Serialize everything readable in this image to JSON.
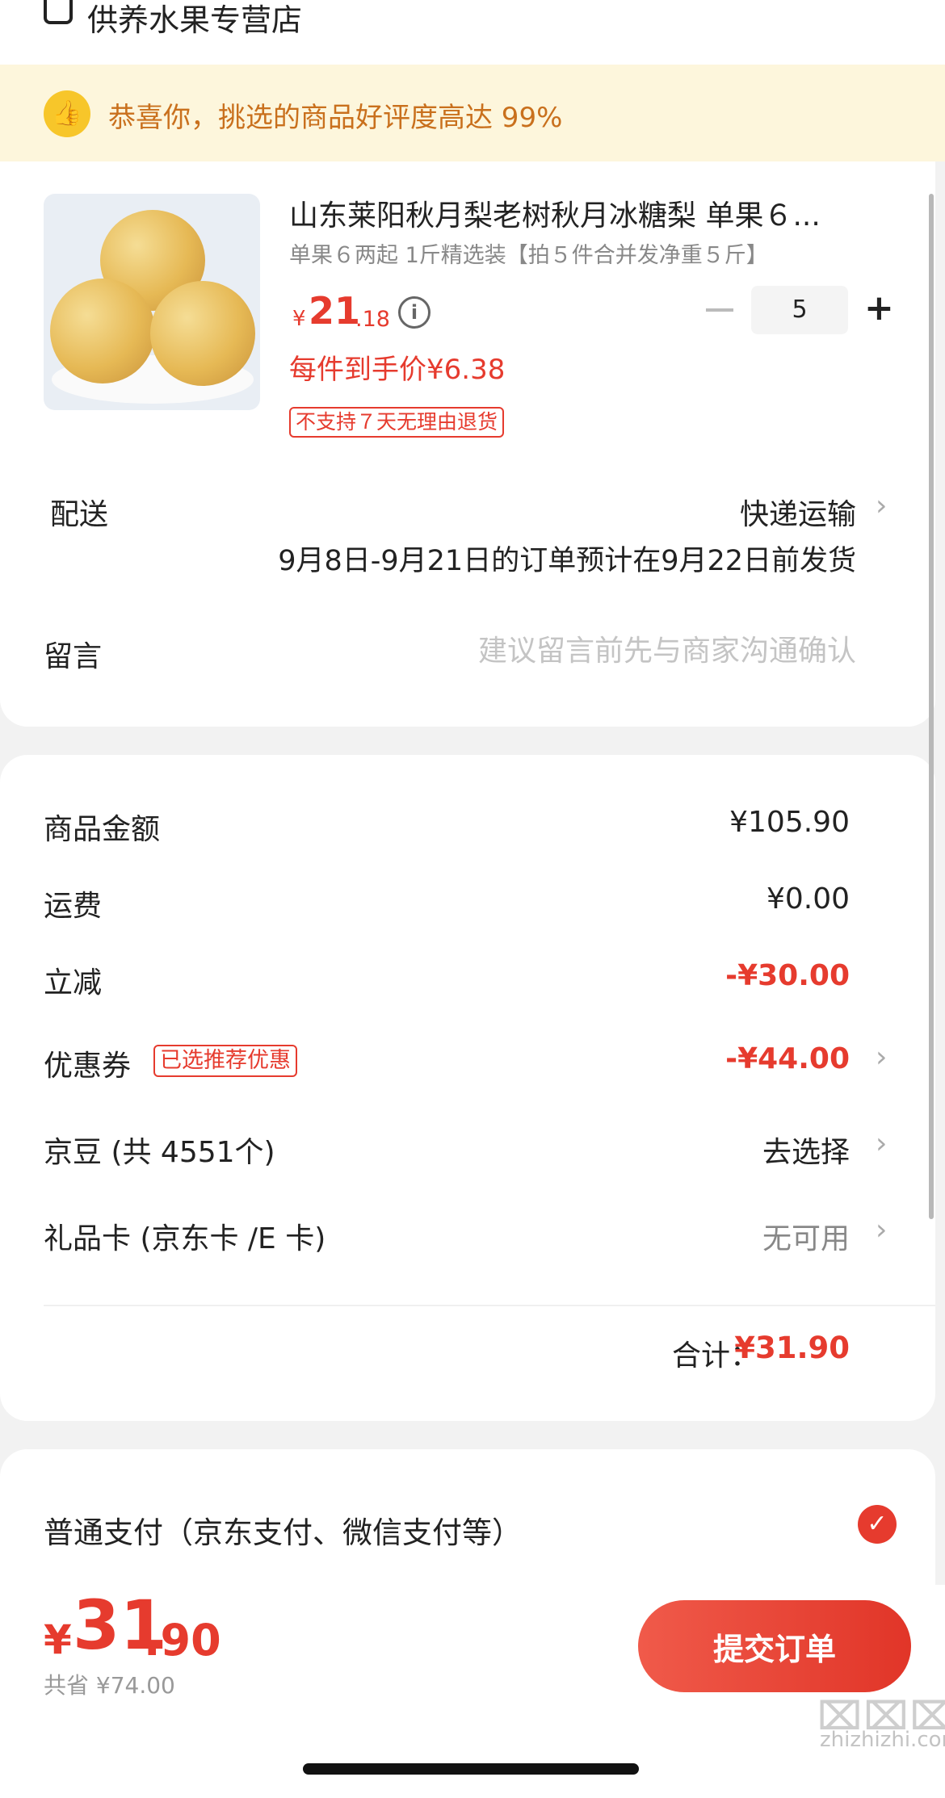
{
  "store": {
    "name": "供养水果专营店"
  },
  "banner": {
    "text": "恭喜你，挑选的商品好评度高达 99%"
  },
  "product": {
    "title": "山东莱阳秋月梨老树秋月冰糖梨 单果６...",
    "spec": "单果６两起 1斤精选装【拍５件合并发净重５斤】",
    "price_symbol": "¥",
    "price_int": "21",
    "price_dec": ".18",
    "quantity": "5",
    "per_item_price": "每件到手价¥6.38",
    "no_return_tag": "不支持７天无理由退货"
  },
  "delivery": {
    "label": "配送",
    "method": "快递运输",
    "note": "9月8日-9月21日的订单预计在9月22日前发货"
  },
  "message": {
    "label": "留言",
    "placeholder": "建议留言前先与商家沟通确认"
  },
  "summary": {
    "goods_label": "商品金额",
    "goods_value": "¥105.90",
    "shipping_label": "运费",
    "shipping_value": "¥0.00",
    "discount_label": "立减",
    "discount_value": "-¥30.00",
    "coupon_label": "优惠券",
    "coupon_tag": "已选推荐优惠",
    "coupon_value": "-¥44.00",
    "jd_beans_label": "京豆 (共 4551个)",
    "jd_beans_value": "去选择",
    "gift_card_label": "礼品卡 (京东卡 /E 卡)",
    "gift_card_value": "无可用",
    "total_label": "合计：",
    "total_value": "¥31.90"
  },
  "payment": {
    "label": "普通支付（京东支付、微信支付等）"
  },
  "bottom": {
    "yen": "¥",
    "total_int": "31",
    "total_dec": ".90",
    "saved": "共省 ¥74.00",
    "submit_label": "提交订单"
  },
  "watermark": {
    "text": "zhizhizhi.com"
  },
  "colors": {
    "accent": "#e63b2e",
    "banner_bg": "#fdf6dc",
    "banner_text": "#c9701d"
  }
}
